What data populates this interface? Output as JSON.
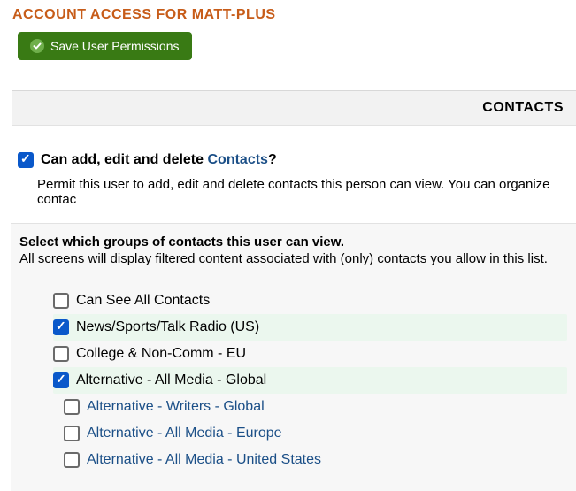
{
  "header": {
    "title": "ACCOUNT ACCESS FOR MATT-PLUS",
    "save_button_label": "Save User Permissions"
  },
  "section": {
    "tab_label": "CONTACTS"
  },
  "permission": {
    "question_prefix": "Can add, edit and delete ",
    "question_link": "Contacts",
    "question_suffix": "?",
    "checked": true,
    "description": "Permit this user to add, edit and delete contacts this person can view. You can organize contac"
  },
  "groups_panel": {
    "heading": "Select which groups of contacts this user can view.",
    "subheading": "All screens will display filtered content associated with (only) contacts you allow in this list."
  },
  "groups": [
    {
      "label": "Can See All Contacts",
      "checked": false,
      "link": false,
      "indent": 1
    },
    {
      "label": "News/Sports/Talk Radio (US)",
      "checked": true,
      "link": false,
      "indent": 1
    },
    {
      "label": "College & Non-Comm - EU",
      "checked": false,
      "link": false,
      "indent": 1
    },
    {
      "label": "Alternative - All Media - Global",
      "checked": true,
      "link": false,
      "indent": 1
    },
    {
      "label": "Alternative - Writers - Global",
      "checked": false,
      "link": true,
      "indent": 2
    },
    {
      "label": "Alternative - All Media - Europe",
      "checked": false,
      "link": true,
      "indent": 2
    },
    {
      "label": "Alternative - All Media - United States",
      "checked": false,
      "link": true,
      "indent": 2
    }
  ]
}
